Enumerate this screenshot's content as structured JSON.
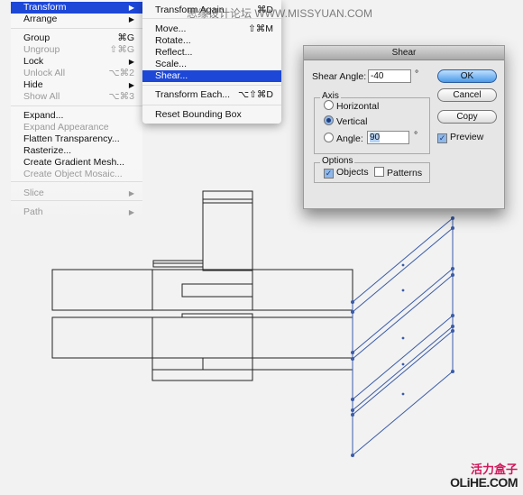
{
  "main_menu": {
    "items": [
      {
        "label": "Transform",
        "submenu": true,
        "selected": true
      },
      {
        "label": "Arrange",
        "submenu": true
      },
      {
        "label": "Group",
        "shortcut": "⌘G"
      },
      {
        "label": "Ungroup",
        "shortcut": "⇧⌘G",
        "disabled": true
      },
      {
        "label": "Lock",
        "submenu": true
      },
      {
        "label": "Unlock All",
        "shortcut": "⌥⌘2",
        "disabled": true
      },
      {
        "label": "Hide",
        "submenu": true
      },
      {
        "label": "Show All",
        "shortcut": "⌥⌘3",
        "disabled": true
      },
      {
        "label": "Expand..."
      },
      {
        "label": "Expand Appearance",
        "disabled": true
      },
      {
        "label": "Flatten Transparency..."
      },
      {
        "label": "Rasterize..."
      },
      {
        "label": "Create Gradient Mesh..."
      },
      {
        "label": "Create Object Mosaic...",
        "disabled": true
      },
      {
        "label": "Slice",
        "submenu": true,
        "disabled": true
      },
      {
        "label": "Path",
        "submenu": true,
        "disabled": true
      }
    ]
  },
  "transform_submenu": {
    "items": [
      {
        "label": "Transform Again",
        "shortcut": "⌘D"
      },
      {
        "label": "Move...",
        "shortcut": "⇧⌘M"
      },
      {
        "label": "Rotate..."
      },
      {
        "label": "Reflect..."
      },
      {
        "label": "Scale..."
      },
      {
        "label": "Shear...",
        "selected": true
      },
      {
        "label": "Transform Each...",
        "shortcut": "⌥⇧⌘D"
      },
      {
        "label": "Reset Bounding Box"
      }
    ]
  },
  "shear_dialog": {
    "title": "Shear",
    "shear_angle_label": "Shear Angle:",
    "shear_angle_value": "-40",
    "degree_symbol": "°",
    "axis_label": "Axis",
    "horizontal_label": "Horizontal",
    "vertical_label": "Vertical",
    "angle_label": "Angle:",
    "angle_value": "90",
    "selected_axis": "Vertical",
    "options_label": "Options",
    "objects_label": "Objects",
    "objects_checked": true,
    "patterns_label": "Patterns",
    "patterns_checked": false,
    "ok_label": "OK",
    "cancel_label": "Cancel",
    "copy_label": "Copy",
    "preview_label": "Preview",
    "preview_checked": true
  },
  "colors": {
    "selection": "#1d47d6",
    "path_selected": "#3a5ba8",
    "stroke": "#222222"
  },
  "watermarks": {
    "top": "思缘设计论坛 WWW.MISSYUAN.COM",
    "bottom_cn": "活力盒子",
    "bottom_en": "OLiHE.COM"
  }
}
